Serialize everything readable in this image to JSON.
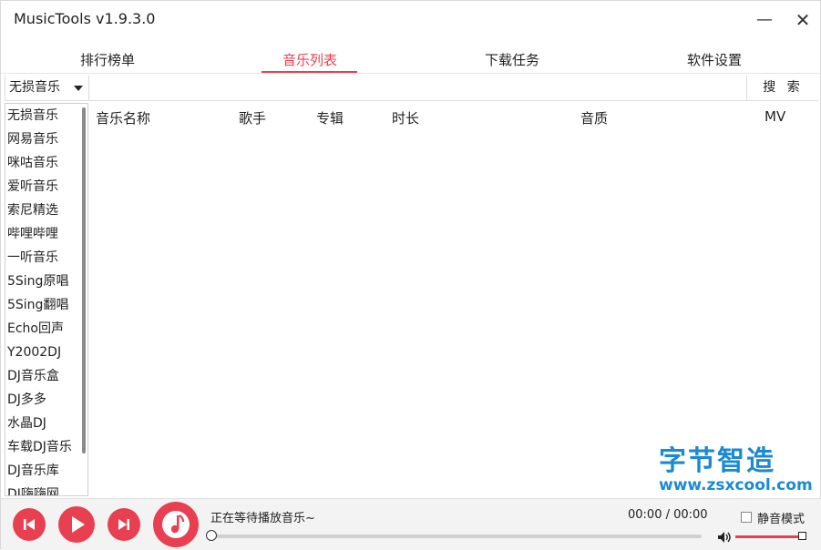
{
  "app": {
    "title": "MusicTools v1.9.3.0",
    "minimize_glyph": "—",
    "close_glyph": "✕"
  },
  "tabs": [
    {
      "label": "排行榜单",
      "active": false
    },
    {
      "label": "音乐列表",
      "active": true
    },
    {
      "label": "下载任务",
      "active": false
    },
    {
      "label": "软件设置",
      "active": false
    }
  ],
  "search": {
    "source_selected": "无损音乐",
    "query_value": "",
    "button_label": "搜 索"
  },
  "sources": [
    "无损音乐",
    "网易音乐",
    "咪咕音乐",
    "爱听音乐",
    "索尼精选",
    "哔哩哔哩",
    "一听音乐",
    "5Sing原唱",
    "5Sing翻唱",
    "Echo回声",
    "Y2002DJ",
    "DJ音乐盒",
    "DJ多多",
    "水晶DJ",
    "车载DJ音乐",
    "DJ音乐库",
    "DJ嗨嗨网"
  ],
  "table": {
    "columns": [
      "音乐名称",
      "歌手",
      "专辑",
      "时长",
      "音质",
      "MV"
    ]
  },
  "watermark": {
    "line1": "字节智造",
    "line2": "www.zsxcool.com"
  },
  "player": {
    "status_text": "正在等待播放音乐~",
    "time_text": "00:00 / 00:00",
    "progress": 0,
    "mute_label": "静音模式",
    "mute_checked": false,
    "volume": 1.0
  },
  "colors": {
    "accent": "#e84050",
    "watermark": "#1a8ad4"
  },
  "icons": [
    "minimize-icon",
    "close-icon",
    "caret-down-icon",
    "previous-icon",
    "play-icon",
    "next-icon",
    "music-note-icon",
    "speaker-icon"
  ]
}
